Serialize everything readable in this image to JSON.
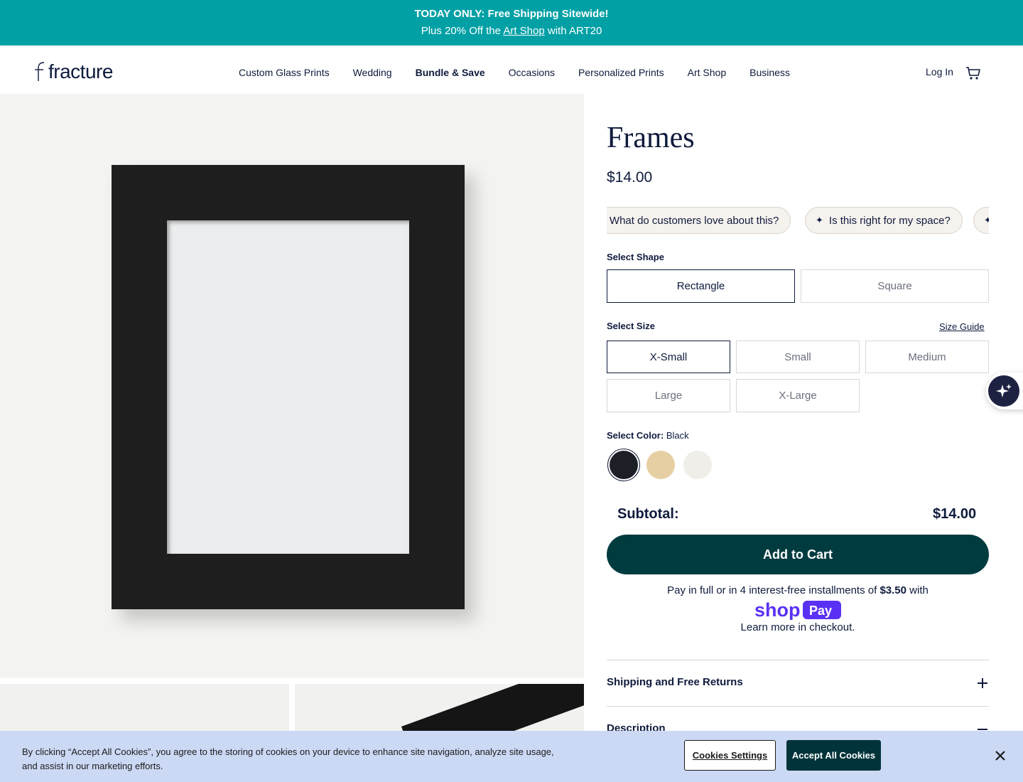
{
  "announcement": {
    "line1": "TODAY ONLY: Free Shipping Sitewide!",
    "line2_before": "Plus 20% Off the",
    "line2_link": "Art Shop",
    "line2_after": "with ART20"
  },
  "header": {
    "logo_text": "fracture",
    "nav": [
      "Custom Glass Prints",
      "Wedding",
      "Bundle & Save",
      "Occasions",
      "Personalized Prints",
      "Art Shop",
      "Business"
    ],
    "login": "Log In",
    "cart_icon": "cart-icon"
  },
  "product": {
    "title": "Frames",
    "price": "$14.00",
    "chips": [
      "What do customers love about this?",
      "Is this right for my space?"
    ],
    "shape": {
      "label": "Select Shape",
      "options": [
        "Rectangle",
        "Square"
      ],
      "selected": "Rectangle"
    },
    "size": {
      "label": "Select Size",
      "guide": "Size Guide",
      "options": [
        "X-Small",
        "Small",
        "Medium",
        "Large",
        "X-Large"
      ],
      "selected": "X-Small"
    },
    "color": {
      "label": "Select Color:",
      "selected": "Black",
      "swatches": [
        "#1d1f26",
        "#e6cfa3",
        "#efeee8"
      ]
    },
    "subtotal_label": "Subtotal:",
    "subtotal_value": "$14.00",
    "add_to_cart": "Add to Cart",
    "pay_text_before": "Pay in full or in 4 interest-free installments of",
    "pay_amount": "$3.50",
    "pay_text_after": "with",
    "learn_more": "Learn more in checkout.",
    "accordions": [
      "Shipping and Free Returns",
      "Description"
    ]
  },
  "cookie": {
    "text": "By clicking “Accept All Cookies”, you agree to the storing of cookies on your device to enhance site navigation, analyze site usage, and assist in our marketing efforts.",
    "settings": "Cookies Settings",
    "accept": "Accept All Cookies"
  },
  "colors": {
    "announce_bg": "#00a0a5",
    "primary": "#0f1b3d",
    "cta": "#003b40",
    "cookie_bg": "#ccd9f5"
  }
}
